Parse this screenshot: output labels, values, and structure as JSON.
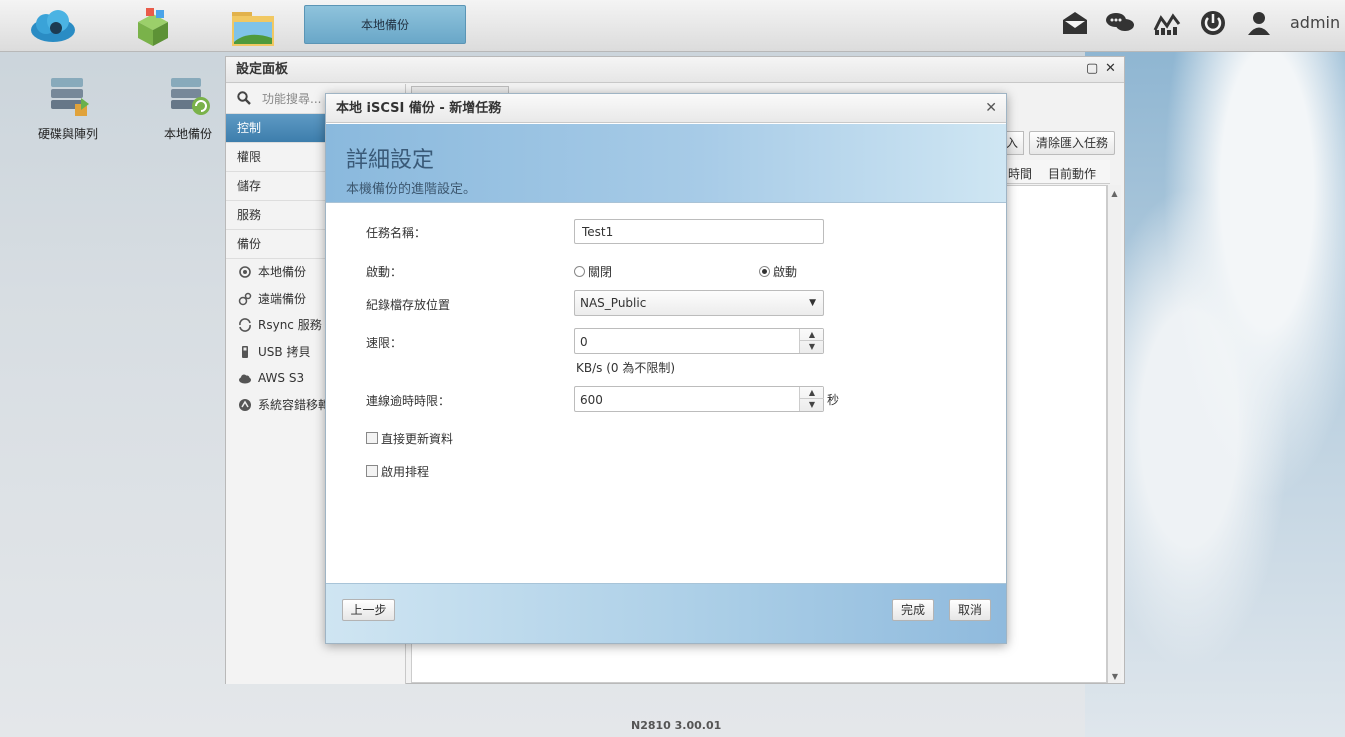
{
  "taskbar": {
    "active_task": "本地備份",
    "user": "admin"
  },
  "desktop": {
    "icons": [
      {
        "label": "硬碟與陣列"
      },
      {
        "label": "本地備份"
      }
    ]
  },
  "settings_panel": {
    "title": "設定面板",
    "search_placeholder": "功能搜尋...",
    "menu": [
      "控制",
      "權限",
      "儲存",
      "服務",
      "備份"
    ],
    "active_menu": "控制",
    "backup_items": [
      "本地備份",
      "遠端備份",
      "Rsync 服務",
      "USB 拷貝",
      "AWS S3",
      "系統容錯移轉"
    ],
    "toolbar": {
      "partial_button": "入",
      "clear_import": "清除匯入任務"
    },
    "grid_columns": [
      "時間",
      "目前動作"
    ]
  },
  "modal": {
    "title": "本地 iSCSI 備份 - 新增任務",
    "banner_title": "詳細設定",
    "banner_subtitle": "本機備份的進階設定。",
    "fields": {
      "task_name_label": "任務名稱：",
      "task_name_value": "Test1",
      "enable_label": "啟動：",
      "radio_off": "關閉",
      "radio_on": "啟動",
      "log_location_label": "紀錄檔存放位置",
      "log_location_value": "NAS_Public",
      "speed_limit_label": "速限：",
      "speed_limit_value": "0",
      "speed_limit_hint": "KB/s (0 為不限制)",
      "timeout_label": "連線逾時時限：",
      "timeout_value": "600",
      "timeout_unit": "秒",
      "direct_update_label": "直接更新資料",
      "schedule_label": "啟用排程"
    },
    "buttons": {
      "prev": "上一步",
      "finish": "完成",
      "cancel": "取消"
    }
  },
  "footer": {
    "version": "N2810   3.00.01"
  },
  "colors": {
    "banner_blue": "#8ab9dd",
    "active_menu_blue": "#3d7eac"
  }
}
